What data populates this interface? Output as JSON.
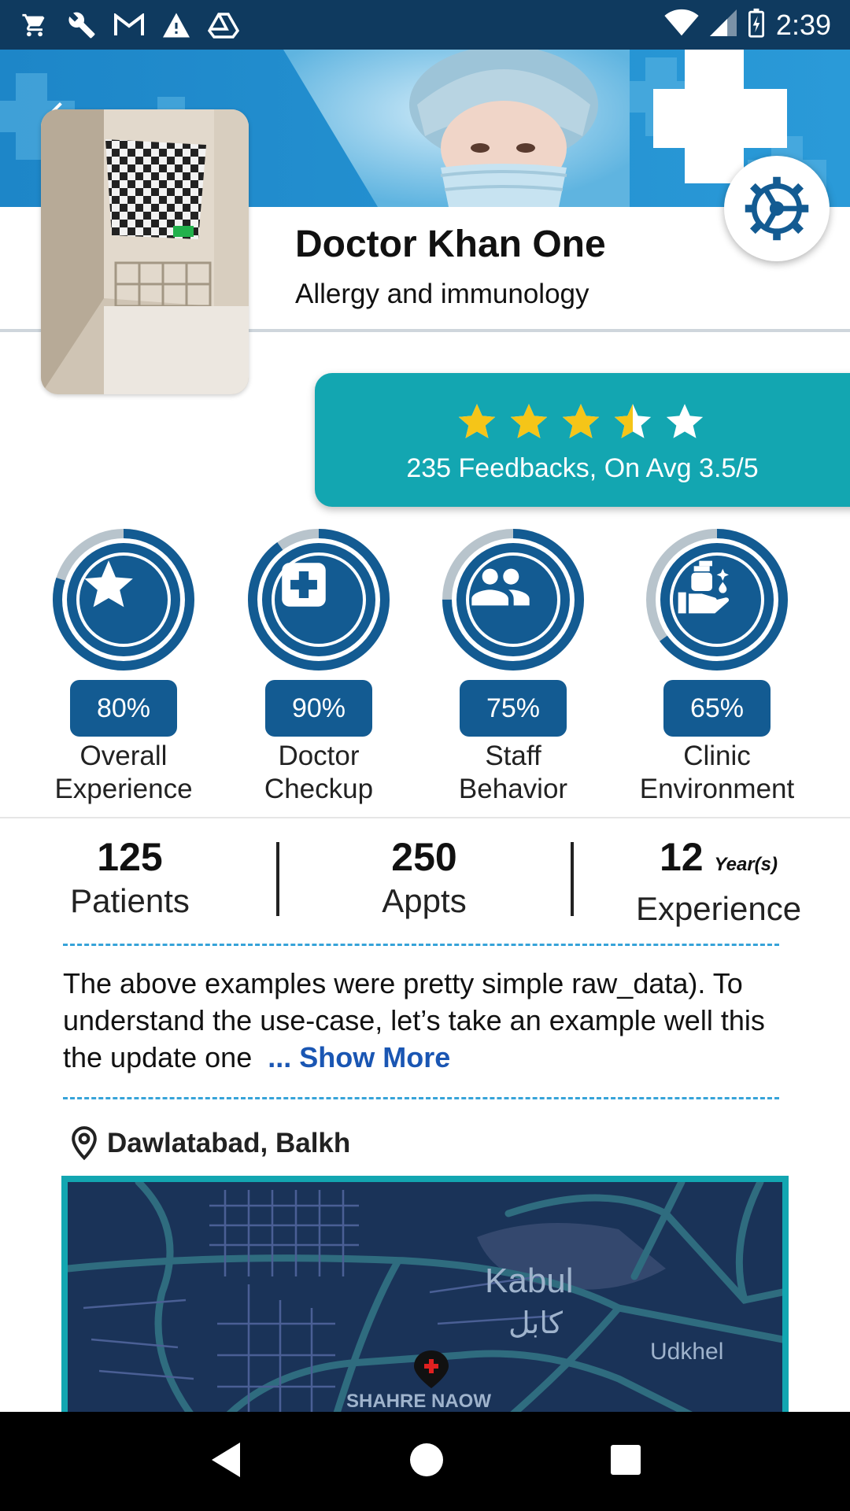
{
  "status_bar": {
    "time": "2:39",
    "icons": [
      "cart-icon",
      "wrench-icon",
      "gmail-icon",
      "warning-icon",
      "drive-icon",
      "wifi-icon",
      "signal-icon",
      "battery-icon"
    ]
  },
  "header": {
    "doctor_name": "Doctor Khan One",
    "specialty": "Allergy and immunology"
  },
  "rating": {
    "stars_value": 3.5,
    "stars_max": 5,
    "summary": "235 Feedbacks, On Avg 3.5/5"
  },
  "metrics": [
    {
      "percent_text": "80%",
      "value": 0.8,
      "label_line1": "Overall",
      "label_line2": "Experience",
      "icon": "star-icon"
    },
    {
      "percent_text": "90%",
      "value": 0.9,
      "label_line1": "Doctor",
      "label_line2": "Checkup",
      "icon": "medical-cross-icon"
    },
    {
      "percent_text": "75%",
      "value": 0.75,
      "label_line1": "Staff",
      "label_line2": "Behavior",
      "icon": "people-icon"
    },
    {
      "percent_text": "65%",
      "value": 0.65,
      "label_line1": "Clinic",
      "label_line2": "Environment",
      "icon": "sanitizer-icon"
    }
  ],
  "stats": [
    {
      "value": "125",
      "unit": "",
      "label": "Patients"
    },
    {
      "value": "250",
      "unit": "",
      "label": "Appts"
    },
    {
      "value": "12",
      "unit": "Year(s)",
      "label": "Experience"
    }
  ],
  "description": {
    "text": "The above examples were pretty simple raw_data). To understand the use-case, let’s take an example well this the update one",
    "show_more": "... Show More"
  },
  "location": {
    "text": "Dawlatabad, Balkh"
  },
  "map": {
    "labels": [
      "Kabul",
      "کابل",
      "Udkhel",
      "SHAHRE NAOW"
    ]
  },
  "colors": {
    "status_bar": "#0f3a5f",
    "primary": "#135b92",
    "teal": "#13a6b1",
    "ring_track": "#b8c4cc",
    "star_gold": "#f5c518",
    "link": "#1a56b3"
  }
}
